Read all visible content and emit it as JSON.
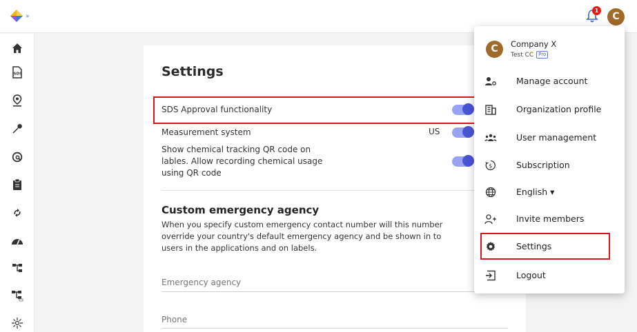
{
  "header": {
    "notification_count": "1",
    "avatar_initial": "C"
  },
  "sidebar": {
    "items": [
      {
        "icon": "home-icon"
      },
      {
        "icon": "sds-icon"
      },
      {
        "icon": "location-icon"
      },
      {
        "icon": "wrench-icon"
      },
      {
        "icon": "search-chemical-icon"
      },
      {
        "icon": "clipboard-icon"
      },
      {
        "icon": "sync-icon"
      },
      {
        "icon": "gauge-icon"
      },
      {
        "icon": "hierarchy-icon"
      },
      {
        "icon": "hierarchy-alt-icon"
      },
      {
        "icon": "sparkle-icon"
      }
    ]
  },
  "settings": {
    "title": "Settings",
    "sds_approval_label": "SDS Approval functionality",
    "measurement_label": "Measurement system",
    "measurement_value": "US",
    "qr_label_line1": "Show chemical tracking QR code on",
    "qr_label_line2": "lables. Allow recording chemical usage",
    "qr_label_line3": "using QR code",
    "agency_title": "Custom emergency agency",
    "agency_desc": "When you specify custom emergency contact number will this number override your country's default emergency agency and be shown in to users in the applications and on labels.",
    "emergency_agency_placeholder": "Emergency agency",
    "phone_placeholder": "Phone"
  },
  "menu": {
    "avatar_initial": "C",
    "company_name": "Company X",
    "account_name": "Test CC",
    "plan_badge": "Pro",
    "items": [
      {
        "label": "Manage account"
      },
      {
        "label": "Organization profile"
      },
      {
        "label": "User management"
      },
      {
        "label": "Subscription"
      },
      {
        "label": "English ▾"
      },
      {
        "label": "Invite members"
      },
      {
        "label": "Settings"
      },
      {
        "label": "Logout"
      }
    ]
  },
  "colors": {
    "accent": "#4a55d6",
    "highlight": "#d9151b",
    "avatar": "#a06a2a"
  }
}
